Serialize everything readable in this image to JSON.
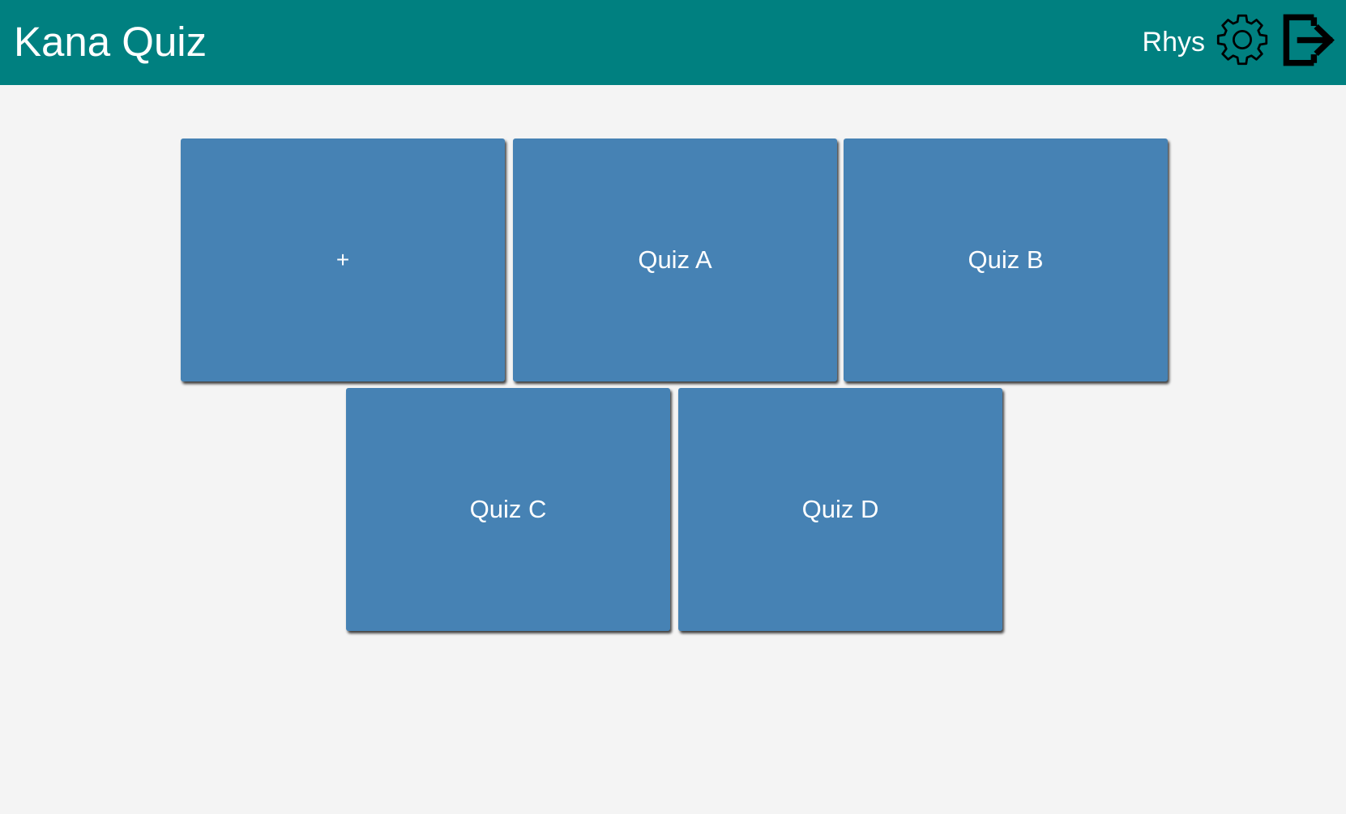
{
  "header": {
    "title": "Kana Quiz",
    "user_name": "Rhys",
    "settings_icon": "gear-icon",
    "logout_icon": "logout-arrow-icon",
    "background_color": "#008080",
    "text_color": "#ffffff"
  },
  "main": {
    "background_color": "#f4f4f4",
    "tiles": [
      {
        "label": "+"
      },
      {
        "label": "Quiz A"
      },
      {
        "label": "Quiz B"
      },
      {
        "label": "Quiz C"
      },
      {
        "label": "Quiz D"
      }
    ],
    "tile_color": "#4682b4",
    "tile_text_color": "#ffffff"
  }
}
